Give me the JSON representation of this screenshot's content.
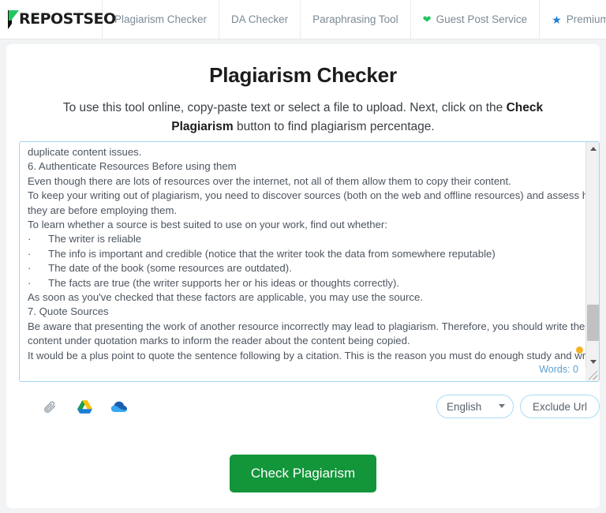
{
  "navbar": {
    "logo_text": "REPOSTSEO",
    "logo_mark": "p-mark-icon",
    "items": [
      {
        "label": "Plagiarism Checker",
        "icon": null
      },
      {
        "label": "DA Checker",
        "icon": null
      },
      {
        "label": "Paraphrasing Tool",
        "icon": null
      },
      {
        "label": "Guest Post Service",
        "icon": "heart-icon"
      },
      {
        "label": "Premium Plans",
        "icon": "star-icon"
      }
    ]
  },
  "page": {
    "title": "Plagiarism Checker",
    "desc_part1": "To use this tool online, copy-paste text or select a file to upload. Next, click on the ",
    "desc_bold": "Check Plagiarism",
    "desc_part2": " button to find plagiarism percentage."
  },
  "editor": {
    "lines": [
      "duplicate content issues.",
      "6. Authenticate Resources Before using them",
      "Even though there are lots of resources over the internet, not all of them allow them to copy their content.",
      "To keep your writing out of plagiarism, you need to discover sources (both on the web and offline resources) and assess how",
      "they are before employing them.",
      "To learn whether a source is best suited to use on your work, find out whether:",
      "·      The writer is reliable",
      "·      The info is important and credible (notice that the writer took the data from somewhere reputable)",
      "·      The date of the book (some resources are outdated).",
      "·      The facts are true (the writer supports her or his ideas or thoughts correctly).",
      "As soon as you've checked that these factors are applicable, you may use the source.",
      "7. Quote Sources",
      "Be aware that presenting the work of another resource incorrectly may lead to plagiarism. Therefore, you should write the",
      "content under quotation marks to inform the reader about the content being copied.",
      "It would be a plus point to quote the sentence following by a citation. This is the reason you must do enough study and write"
    ],
    "word_count_label": "Words: 0",
    "scroll_up_icon": "arrow-up-icon",
    "scroll_down_icon": "arrow-down-icon",
    "resize_icon": "resize-grip-icon",
    "cursor_marker": "cursor-dot"
  },
  "toolbar": {
    "upload_icons": [
      {
        "name": "paperclip-icon",
        "title": "Attach file"
      },
      {
        "name": "google-drive-icon",
        "title": "Google Drive"
      },
      {
        "name": "cloud-icon",
        "title": "Cloud storage"
      }
    ],
    "language": {
      "selected": "English",
      "options": [
        "English"
      ]
    },
    "exclude_url_label": "Exclude Url"
  },
  "submit": {
    "label": "Check Plagiarism"
  },
  "colors": {
    "brand_green": "#13953a",
    "logo_green": "#22c55e",
    "accent_blue": "#9fd6f5",
    "star_blue": "#1b7fd4",
    "cursor_orange": "#f5b221",
    "page_bg": "#f1f3f4"
  }
}
